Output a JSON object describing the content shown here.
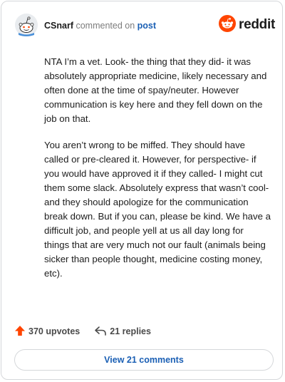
{
  "header": {
    "username": "CSnarf",
    "action": "commented on",
    "post_link": "post",
    "logo_text": "reddit",
    "avatar_icon": "snoo-avatar-icon",
    "logo_icon": "reddit-snoo-icon"
  },
  "comment": {
    "paragraphs": [
      "NTA I’m a vet. Look- the thing that they did- it was absolutely appropriate medicine, likely necessary and often done at the time of spay/neuter. However communication is key here and they fell down on the job on that.",
      "You aren’t wrong to be miffed. They should have called or pre-cleared it. However, for perspective- if you would have approved it if they called- I might cut them some slack. Absolutely express that wasn’t cool- and they should apologize for the communication break down. But if you can, please be kind. We have a difficult job, and people yell at us all day long for things that are very much not our fault (animals being sicker than people thought, medicine costing money, etc)."
    ]
  },
  "stats": {
    "upvotes": "370 upvotes",
    "replies": "21 replies",
    "upvote_icon": "upvote-arrow-icon",
    "reply_icon": "reply-arrow-icon"
  },
  "footer": {
    "view_comments": "View 21 comments"
  },
  "colors": {
    "accent_orange": "#ff4500",
    "link_blue": "#1a5fb4",
    "border": "#d5d7da"
  }
}
